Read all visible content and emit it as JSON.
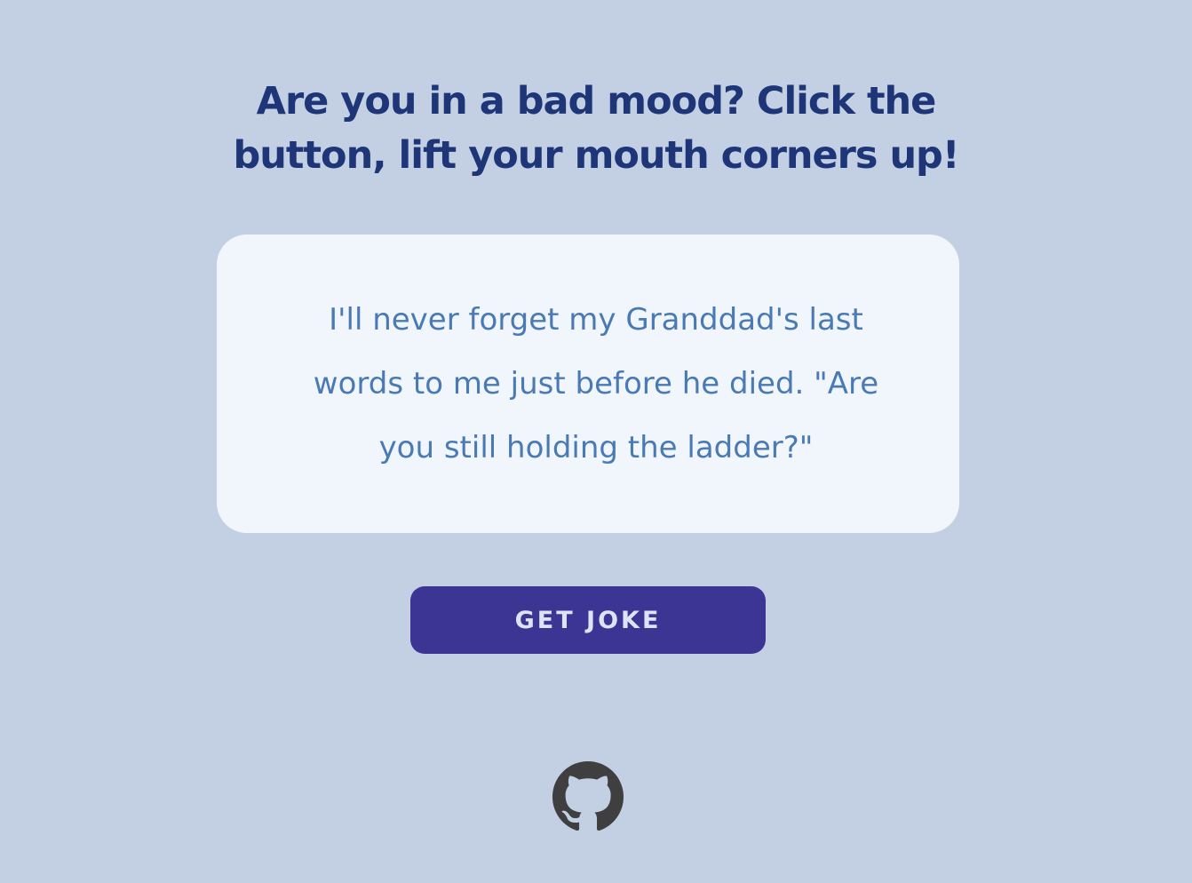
{
  "page": {
    "headline": {
      "line1": "Are you in a bad mood? Click the",
      "line2": "button, lift your mouth corners up!"
    },
    "joke": {
      "line1": "I'll never forget my Granddad's last",
      "line2": "words to me just before he died. \"Are",
      "line3": "you still holding the ladder?\""
    },
    "button": {
      "label": "GET JOKE"
    },
    "footer": {
      "icon": "github-icon"
    }
  },
  "colors": {
    "background": "#c3cfe3",
    "headline": "#1e3578",
    "card": "#f1f6fc",
    "joke_text": "#4a7ab5",
    "button": "#3d3594",
    "button_text": "#dde4f6",
    "github_icon": "#3f3f3f"
  }
}
